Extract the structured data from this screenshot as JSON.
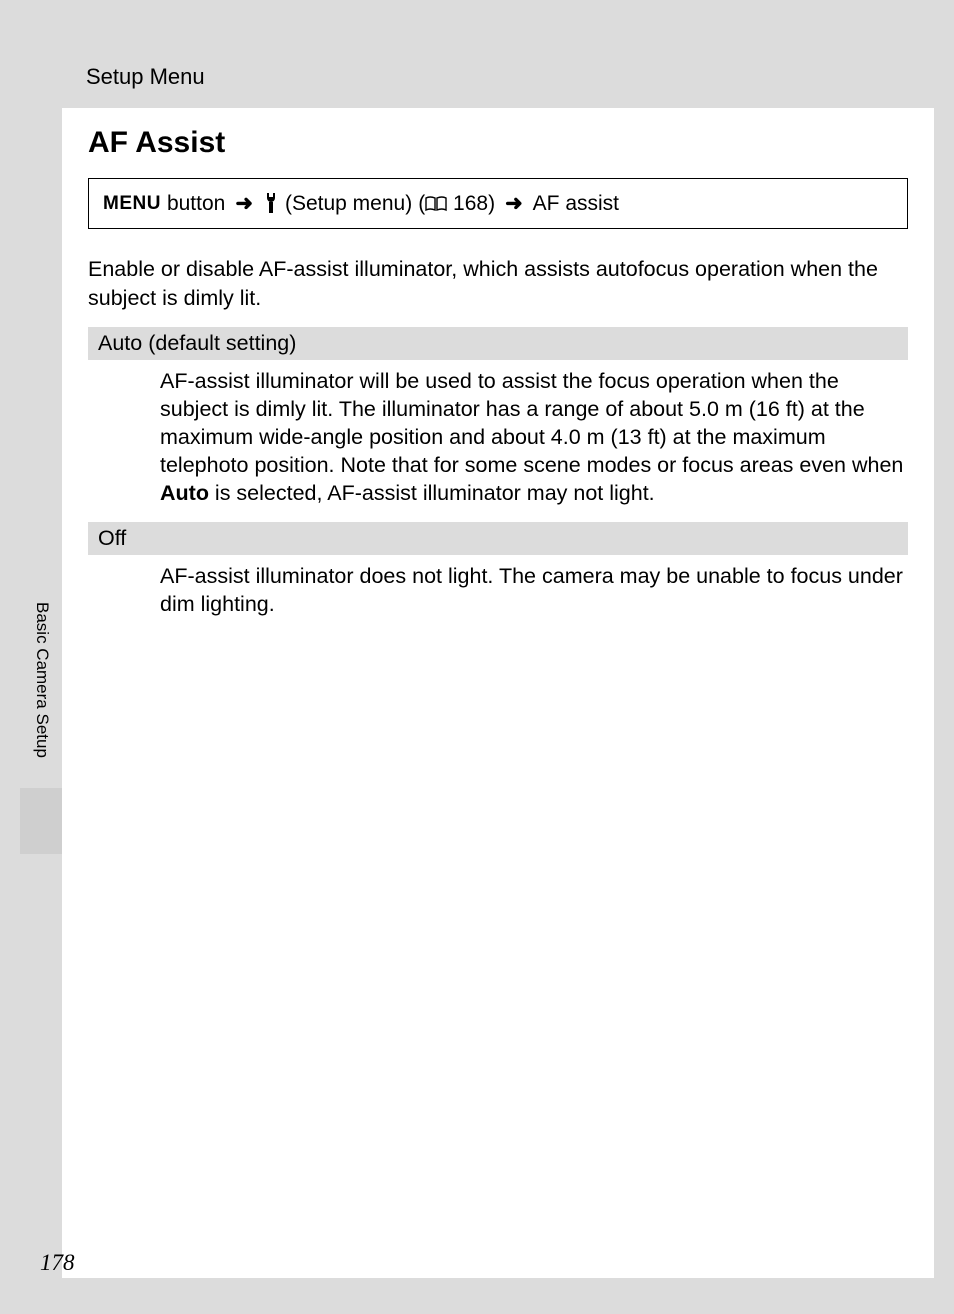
{
  "header": {
    "section": "Setup Menu"
  },
  "title": "AF Assist",
  "nav": {
    "menu_label": "MENU",
    "button_word": "button",
    "setup_menu_label": "(Setup menu)",
    "page_ref": "168)",
    "final": "AF assist"
  },
  "intro": "Enable or disable AF-assist illuminator, which assists autofocus operation when the subject is dimly lit.",
  "options": [
    {
      "name": "Auto (default setting)",
      "body_pre": "AF-assist illuminator will be used to assist the focus operation when the subject is dimly lit. The illuminator has a range of about 5.0 m (16 ft) at the maximum wide-angle position and about 4.0 m (13 ft) at the maximum telephoto position.\nNote that for some scene modes or focus areas even when ",
      "body_bold": "Auto",
      "body_post": " is selected, AF-assist illuminator may not light."
    },
    {
      "name": "Off",
      "body_pre": "AF-assist illuminator does not light. The camera may be unable to focus under dim lighting.",
      "body_bold": "",
      "body_post": ""
    }
  ],
  "side_tab": "Basic Camera Setup",
  "page_number": "178"
}
